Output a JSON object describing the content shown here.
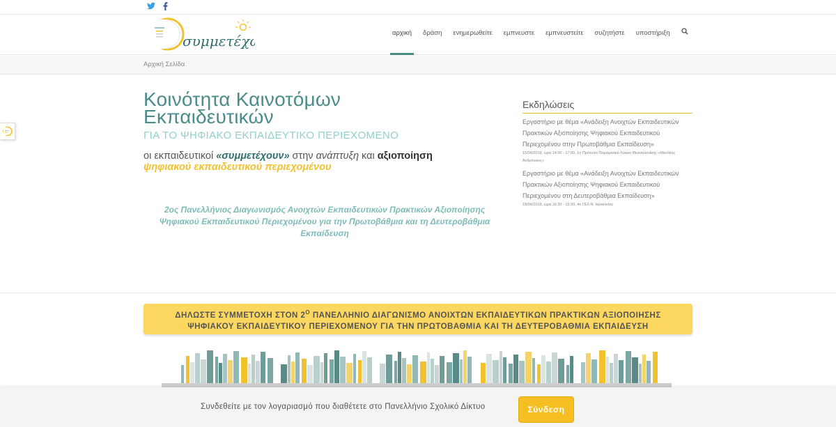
{
  "topbar": {
    "twitter_icon": "twitter-icon",
    "facebook_icon": "facebook-icon"
  },
  "header": {
    "logo_text": "συμμετέχω",
    "nav": [
      "αρχική",
      "δράση",
      "ενημερωθείτε",
      "εμπνευστε",
      "εμπνευστείτε",
      "συζητήστε",
      "υποστήριξη"
    ],
    "search_icon": "search-icon"
  },
  "breadcrumb": "Αρχική Σελίδα",
  "hero": {
    "title_line1": "Κοινότητα Καινοτόμων",
    "title_line2": "Εκπαιδευτικών",
    "subtitle": "ΓΙΑ ΤΟ ΨΗΦΙΑΚΟ ΕΚΠΑΙΔΕΥΤΙΚΟ ΠΕΡΙΕΧΟΜΕΝΟ",
    "tag_1": "οι εκπαιδευτικοί ",
    "tag_2": "«συμμετέχουν»",
    "tag_3": " στην ",
    "tag_4": "ανάπτυξη",
    "tag_5": " και ",
    "tag_6": "αξιοποίηση",
    "tag_7": "ψηφιακού εκπαιδευτικού περιεχομένου",
    "competition_line1": "2ος Πανελλήνιος Διαγωνισμός Ανοιχτών Εκπαιδευτικών Πρακτικών Αξιοποίησης",
    "competition_line2": "Ψηφιακού Εκπαιδευτικού Περιεχομένου για την Πρωτοβάθμια και τη Δευτεροβάθμια",
    "competition_line3": "Εκπαίδευση"
  },
  "events": {
    "title": "Εκδηλώσεις",
    "items": [
      {
        "text": "Εργαστήριο με θέμα «Ανάδειξη Ανοιχτών Εκπαιδευτικών Πρακτικών Αξιοποίησης Ψηφιακού Εκπαιδευτικού Περιεχομένου στην Πρωτοβάθμια Εκπαίδευση»",
        "meta": "15/06/2018, ώρα 14:00 - 17:00, 1ο Πρότυπο Πειραματικό Λύκειο Θεσσαλονίκης «Μανόλης Ανδρόνικος»"
      },
      {
        "text": "Εργαστήριο με θέμα «Ανάδειξη Ανοιχτών Εκπαιδευτικών Πρακτικών Αξιοποίησης Ψηφιακού Εκπαιδευτικού Περιεχομένου στη Δευτεροβάθμια Εκπαίδευση»",
        "meta": "18/06/2018, ώρα 16:30 - 19:30, 4ο ΓΕΛ Ν. Ηρακλείου"
      }
    ]
  },
  "banner": {
    "line1_a": "ΔΗΛΩΣΤΕ ΣΥΜΜΕΤΟΧΗ ΣΤΟΝ 2",
    "line1_sup": "Ο",
    "line1_b": " ΠΑΝΕΛΛΗΝΙΟ ΔΙΑΓΩΝΙΣΜΟ ΑΝΟΙΧΤΩΝ ΕΚΠΑΙΔΕΥΤΙΚΩΝ ΠΡΑΚΤΙΚΩΝ ΑΞΙΟΠΟΙΗΣΗΣ",
    "line2": "ΨΗΦΙΑΚΟΥ ΕΚΠΑΙΔΕΥΤΙΚΟΥ ΠΕΡΙΕΧΟΜΕΝΟΥ ΓΙΑ ΤΗΝ ΠΡΩΤΟΒΑΘΜΙΑ ΚΑΙ ΤΗ ΔΕΥΤΕΡΟΒΑΘΜΙΑ ΕΚΠΑΙΔΕΥΣΗ"
  },
  "login_bar": {
    "text": "Συνδεθείτε με τον λογαριασμό που διαθέτετε στο Πανελλήνιο Σχολικό Δίκτυο",
    "button": "Σύνδεση"
  },
  "colors": {
    "accent": "#4b8c8a",
    "yellow": "#f2c12e",
    "light_teal": "#8fd0cd"
  }
}
